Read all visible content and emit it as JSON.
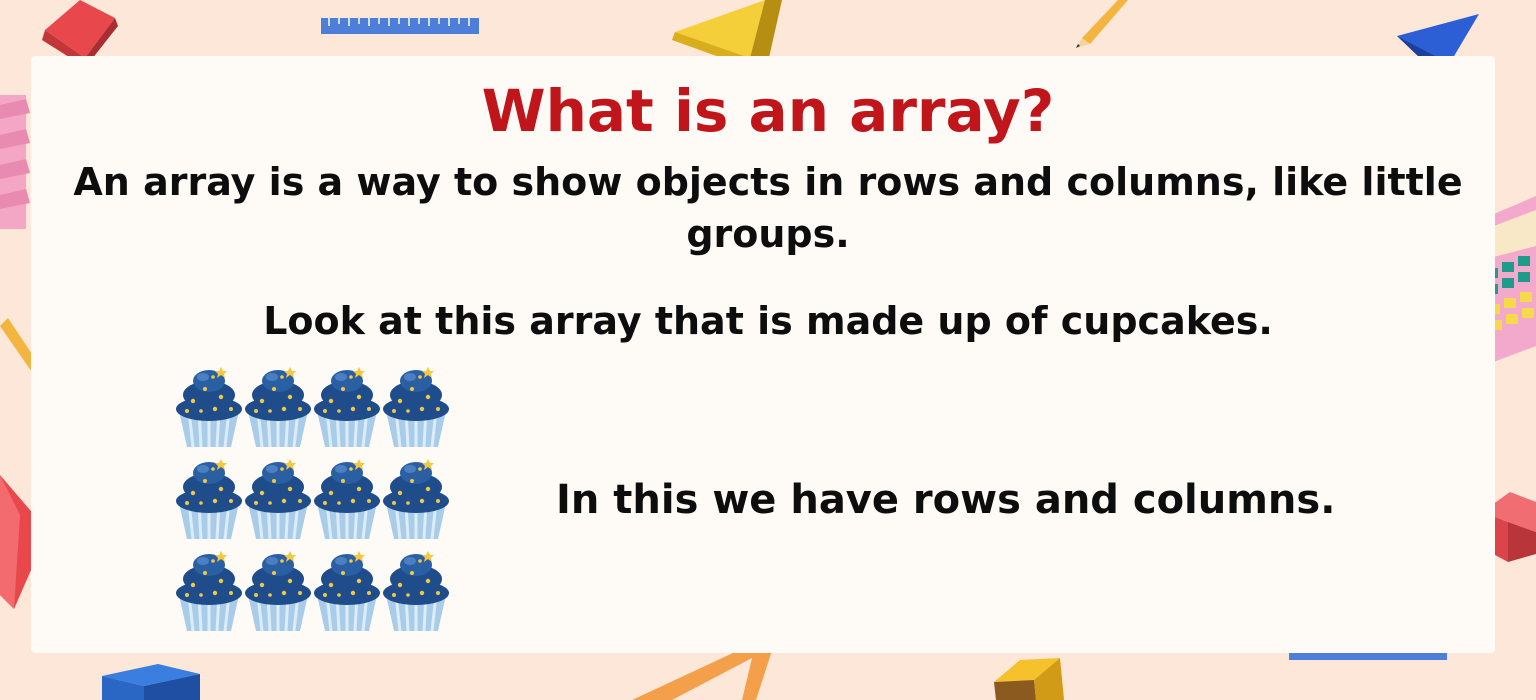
{
  "slide": {
    "title": "What is an array?",
    "intro": "An array is a way to show objects in rows and columns, like little groups.",
    "look": "Look at this array that is made up of cupcakes.",
    "rows_text": "In this we have rows and columns."
  },
  "array": {
    "object": "cupcake",
    "rows": 3,
    "columns": 4
  },
  "colors": {
    "background": "#fde7d8",
    "card": "#fefbf7",
    "title": "#c0161b",
    "text": "#0d0d0d",
    "cupcake_frosting": "#1f4d8c",
    "cupcake_liner": "#a9cde8"
  },
  "decorations": [
    "red-cube-icon",
    "ruler-icon",
    "yellow-prism-icon",
    "pencil-icon",
    "blue-pyramid-icon",
    "pink-blocks-icon",
    "calculator-icon",
    "red-gem-icon",
    "red-cube-icon",
    "blue-cube-icon",
    "orange-triangle-icon",
    "yellow-cube-icon"
  ]
}
